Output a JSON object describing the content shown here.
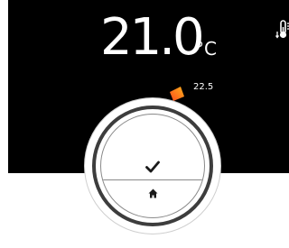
{
  "display": {
    "current_temperature": "21.0",
    "unit": "°C",
    "setpoint_value": "22.5"
  },
  "icons": {
    "thermostat": "thermometer-icon",
    "confirm": "check-icon",
    "home": "home-icon",
    "setpoint_marker": "setpoint-marker-icon"
  },
  "colors": {
    "screen_background": "#000000",
    "text": "#ffffff",
    "marker_start": "#ff4a1c",
    "marker_end": "#ffb21c",
    "ring": "#3d3d3d"
  }
}
